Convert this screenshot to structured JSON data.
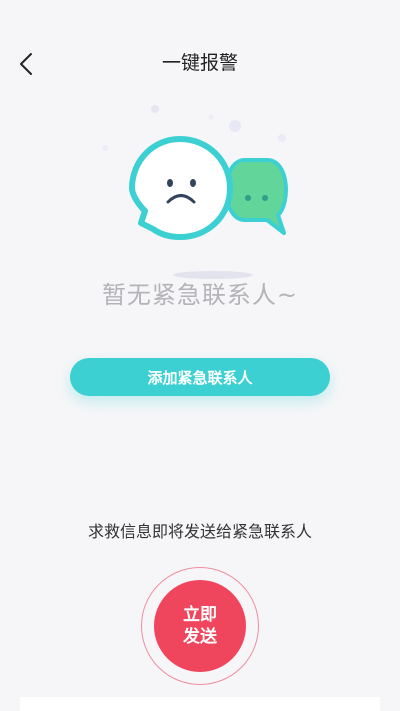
{
  "header": {
    "title": "一键报警",
    "back_icon": "chevron-left-icon"
  },
  "empty_state": {
    "illustration_icon": "sad-chat-bubbles-icon",
    "message": "暂无紧急联系人~"
  },
  "add_contact": {
    "label": "添加紧急联系人"
  },
  "hint": {
    "text": "求救信息即将发送给紧急联系人"
  },
  "send": {
    "label_line1": "立即",
    "label_line2": "发送"
  },
  "colors": {
    "accent": "#3dd0d2",
    "alert": "#f0465d",
    "background": "#f6f6f8"
  }
}
